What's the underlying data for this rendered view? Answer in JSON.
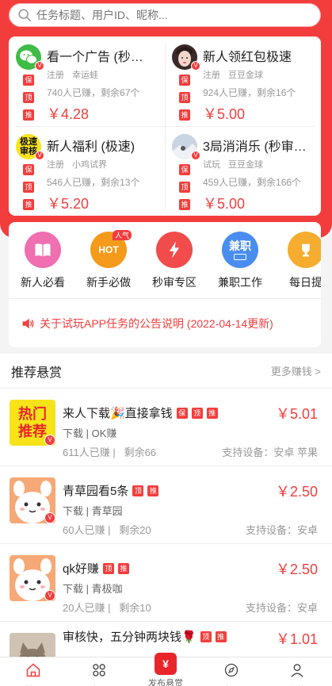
{
  "search": {
    "placeholder": "任务标题、用户ID、昵称..."
  },
  "colors": {
    "accent": "#f33d3d"
  },
  "featured": [
    {
      "title": "看一个广告 (秒…",
      "category": "注册",
      "user": "幸运蛙",
      "stats": "740人已赚，剩余67个",
      "price": "￥4.28",
      "tags": [
        "保",
        "顶",
        "推"
      ],
      "logo": "wechat-logo"
    },
    {
      "title": "新人领红包极速",
      "category": "注册",
      "user": "豆豆金球",
      "stats": "924人已赚，剩余16个",
      "price": "￥5.00",
      "tags": [
        "保",
        "顶",
        "推"
      ],
      "logo": "avatar-girl"
    },
    {
      "title": "新人福利 (极速)",
      "category": "注册",
      "user": "小鸡试界",
      "stats": "546人已赚，剩余13个",
      "price": "￥5.20",
      "tags": [
        "保",
        "顶",
        "推"
      ],
      "logo": "jisu-shenhe-badge",
      "logo_text": "极速审核"
    },
    {
      "title": "3局消消乐 (秒审…",
      "category": "试玩",
      "user": "豆豆金球",
      "stats": "459人已赚，剩余166个",
      "price": "￥5.00",
      "tags": [
        "保",
        "顶",
        "推"
      ],
      "logo": "avatar-snow"
    }
  ],
  "quick": [
    {
      "label": "新人必看",
      "icon": "book-icon",
      "color": "#f06fb0"
    },
    {
      "label": "新手必做",
      "icon": "hot-icon",
      "color": "#f59a1b",
      "badge": "人气",
      "inner": "HOT"
    },
    {
      "label": "秒审专区",
      "icon": "lightning-icon",
      "color": "#f24b4b"
    },
    {
      "label": "兼职工作",
      "icon": "job-icon",
      "color": "#4a8df0",
      "inner": "兼职"
    },
    {
      "label": "每日提",
      "icon": "trophy-icon",
      "color": "#f6ad2f"
    }
  ],
  "notice": "关于试玩APP任务的公告说明 (2022-04-14更新)",
  "recommend": {
    "title": "推荐悬赏",
    "more": "更多赚钱 >"
  },
  "tasks": [
    {
      "name": "来人下载🎉直接拿钱",
      "tags": [
        "保",
        "顶",
        "推"
      ],
      "type": "下载",
      "user": "OK赚",
      "earned": "611人已赚",
      "remain": "剩余66",
      "price": "￥5.01",
      "devices": "支持设备：安卓 苹果",
      "thumb": "hot-recommend",
      "thumb_text": "热门推荐"
    },
    {
      "name": "青草园看5条",
      "tags": [
        "顶",
        "推"
      ],
      "type": "下载",
      "user": "青草园",
      "earned": "60人已赚",
      "remain": "剩余20",
      "price": "￥2.50",
      "devices": "支持设备：安卓",
      "thumb": "cartoon-bunny"
    },
    {
      "name": "qk好赚",
      "tags": [
        "顶",
        "推"
      ],
      "type": "下载",
      "user": "青极咖",
      "earned": "20人已赚",
      "remain": "剩余10",
      "price": "￥2.50",
      "devices": "支持设备：安卓",
      "thumb": "cartoon-bunny"
    },
    {
      "name": "审核快，五分钟两块钱🌹",
      "tags": [
        "顶",
        "推"
      ],
      "type": "",
      "user": "",
      "earned": "",
      "remain": "",
      "price": "￥1.01",
      "devices": "",
      "thumb": "cat-photo"
    }
  ],
  "tabbar": [
    {
      "label": "首页",
      "icon": "home-icon",
      "active": true
    },
    {
      "label": "大厅",
      "icon": "grid-icon"
    },
    {
      "label": "发布悬赏",
      "icon": "money-bag-icon"
    },
    {
      "label": "发现",
      "icon": "compass-icon"
    },
    {
      "label": "我的",
      "icon": "user-icon"
    }
  ]
}
